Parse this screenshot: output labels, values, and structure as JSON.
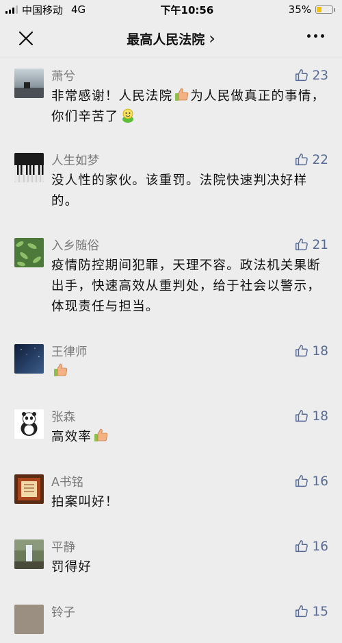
{
  "status": {
    "carrier": "中国移动",
    "network": "4G",
    "time": "下午10:56",
    "battery": "35%",
    "battery_level": 0.35
  },
  "nav": {
    "title": "最高人民法院",
    "chevron": "›"
  },
  "colors": {
    "like": "#576b95",
    "name": "#7a7a7a",
    "background": "#ededed"
  },
  "comments": [
    {
      "name": "萧兮",
      "likes": "23",
      "text": "非常感谢！人民法院👍为人民做真正的事情，你们辛苦了🙂",
      "parts": [
        "非常感谢！人民法院",
        "为人民做真正的事情，你们辛苦了",
        ""
      ],
      "icons": [
        "thumbs-up-emoji",
        "smiley-emoji"
      ]
    },
    {
      "name": "人生如梦",
      "likes": "22",
      "text": "没人性的家伙。该重罚。法院快速判决好样的。"
    },
    {
      "name": "入乡随俗",
      "likes": "21",
      "text": "疫情防控期间犯罪，天理不容。政法机关果断出手，快速高效从重判处，给于社会以警示，体现责任与担当。"
    },
    {
      "name": "王律师",
      "likes": "18",
      "text": ""
    },
    {
      "name": "张森",
      "likes": "18",
      "text": "高效率"
    },
    {
      "name": "A书铭",
      "likes": "16",
      "text": "拍案叫好！"
    },
    {
      "name": "平静",
      "likes": "16",
      "text": "罚得好"
    },
    {
      "name": "铃子",
      "likes": "15",
      "text": ""
    }
  ]
}
